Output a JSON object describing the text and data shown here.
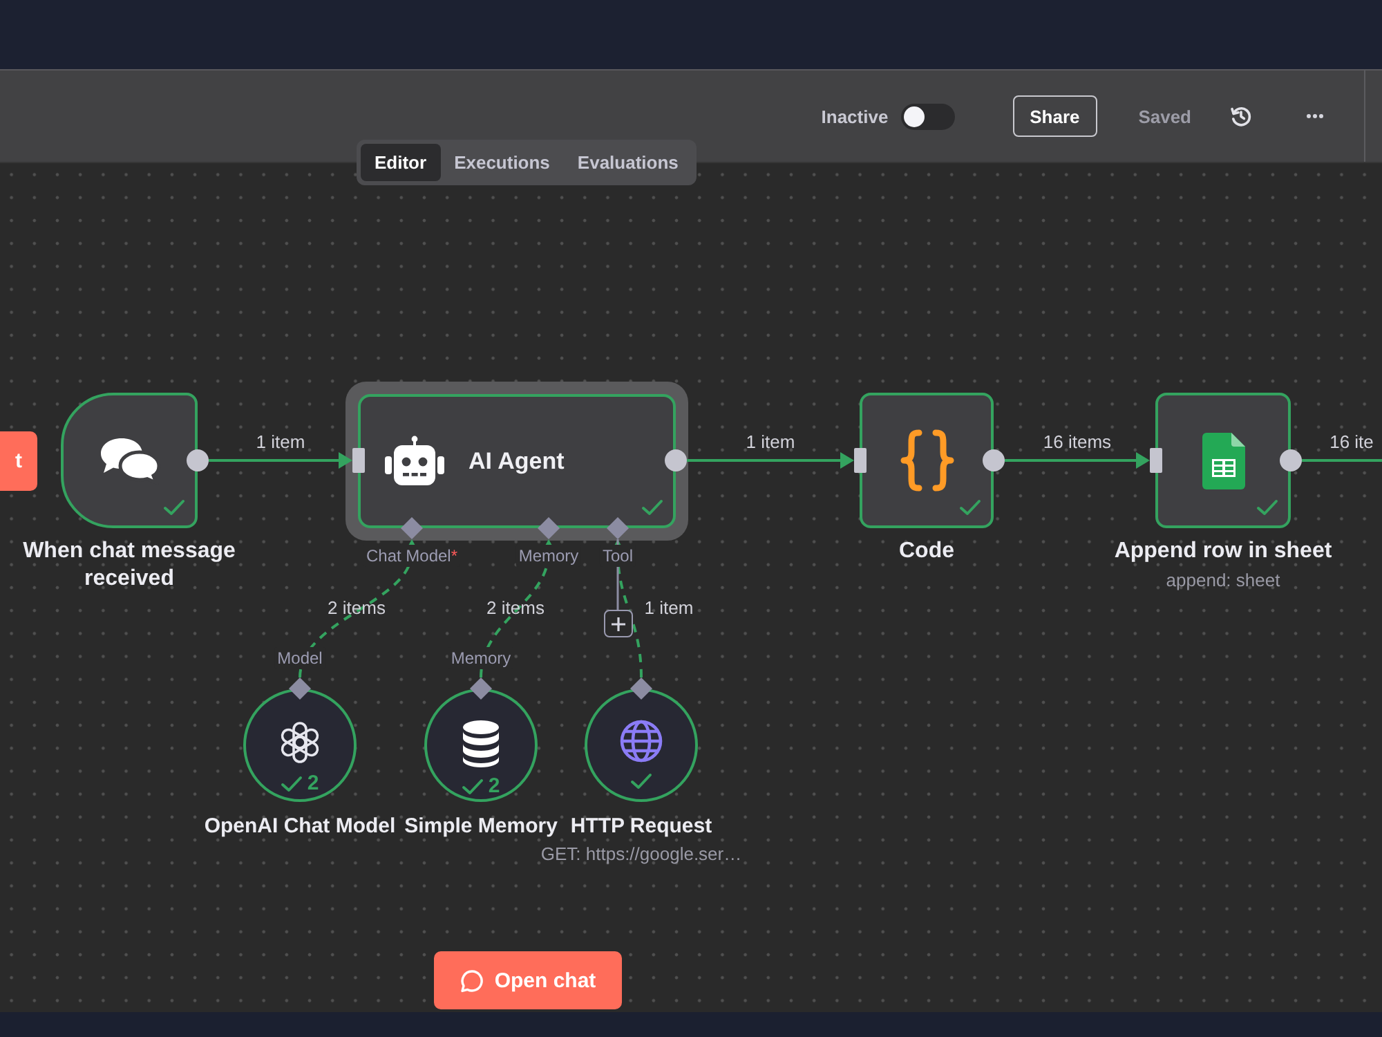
{
  "header": {
    "status_toggle": {
      "label": "Inactive",
      "on": false
    },
    "share_button": "Share",
    "save_status": "Saved"
  },
  "tabs": [
    {
      "label": "Editor",
      "selected": true
    },
    {
      "label": "Executions",
      "selected": false
    },
    {
      "label": "Evaluations",
      "selected": false
    }
  ],
  "canvas": {
    "cut_off_button": {
      "label": "t"
    },
    "nodes": [
      {
        "kind": "trigger",
        "title": "When chat message received",
        "selected": false,
        "success": true
      },
      {
        "kind": "agent",
        "title": "AI Agent",
        "selected": true,
        "success": true,
        "ports": [
          {
            "label": "Chat Model",
            "required_mark": "*"
          },
          {
            "label": "Memory"
          },
          {
            "label": "Tool"
          }
        ]
      },
      {
        "kind": "code",
        "title": "Code",
        "selected": false,
        "success": true
      },
      {
        "kind": "sheet",
        "title": "Append row in sheet",
        "subtitle": "append: sheet",
        "selected": false,
        "success": true
      }
    ],
    "connections": [
      {
        "label": "1 item"
      },
      {
        "label": "1 item"
      },
      {
        "label": "16 items"
      },
      {
        "label": "16 ite"
      }
    ],
    "sub_nodes": [
      {
        "kind": "chat_model",
        "title": "OpenAI Chat Model",
        "port_label": "Model",
        "connection_label": "2 items",
        "run_count": "2",
        "success": true
      },
      {
        "kind": "memory",
        "title": "Simple Memory",
        "port_label": "Memory",
        "connection_label": "2 items",
        "run_count": "2",
        "success": true
      },
      {
        "kind": "tool",
        "title": "HTTP Request",
        "subtitle": "GET: https://google.ser…",
        "connection_label": "1 item",
        "success": true
      }
    ],
    "open_chat_button": {
      "label": "Open chat"
    }
  }
}
